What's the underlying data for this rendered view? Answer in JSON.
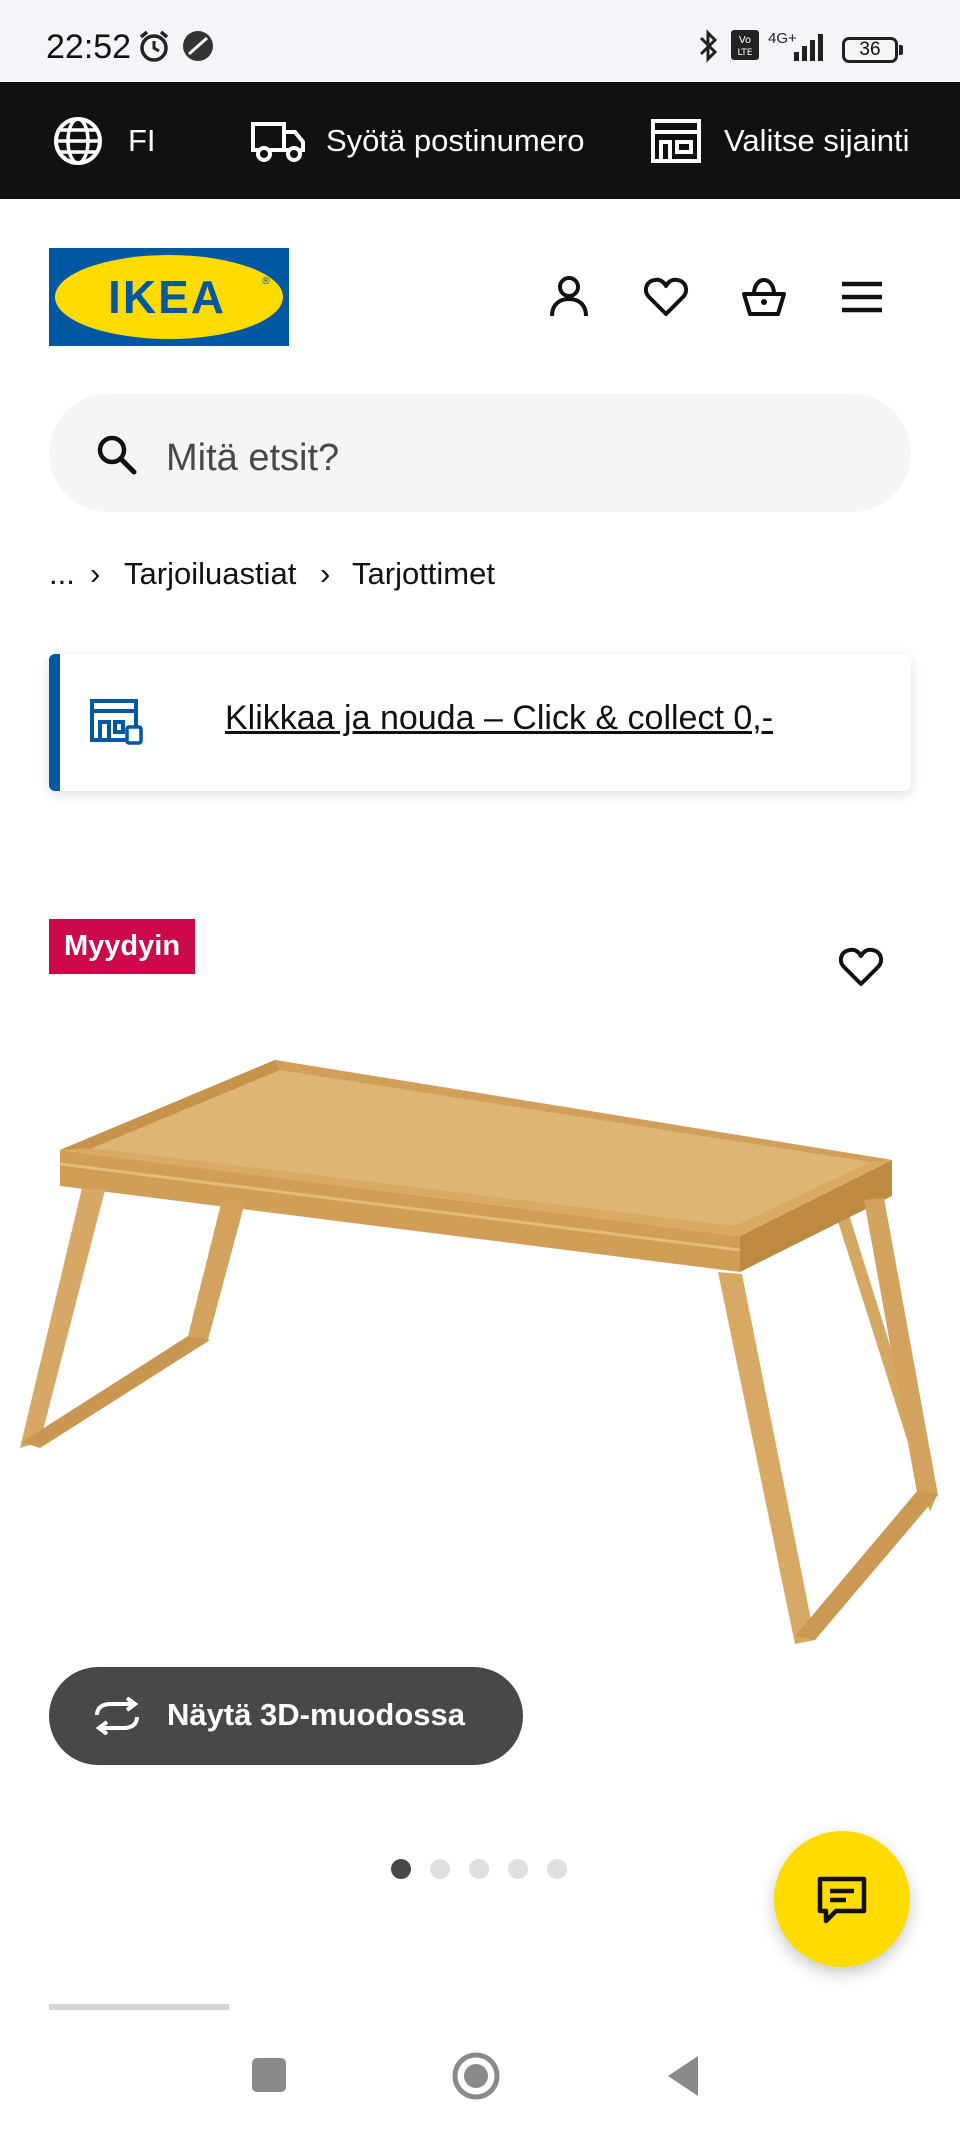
{
  "status_bar": {
    "time": "22:52",
    "battery": "36",
    "network": "4G+"
  },
  "top_bar": {
    "language": "FI",
    "postal_code_label": "Syötä postinumero",
    "location_label": "Valitse sijainti"
  },
  "header": {
    "logo_text": "IKEA"
  },
  "search": {
    "placeholder": "Mitä etsit?"
  },
  "breadcrumb": {
    "ellipsis": "...",
    "items": [
      "Tarjoiluastiat",
      "Tarjottimet"
    ]
  },
  "promo": {
    "text": "Klikkaa ja nouda – Click & collect 0,-"
  },
  "product": {
    "badge": "Myydyin",
    "view_3d_label": "Näytä 3D-muodossa",
    "image_count": 5,
    "active_image": 1
  },
  "colors": {
    "brand_blue": "#0058a3",
    "brand_yellow": "#ffdb00",
    "badge_red": "#cc0a4b",
    "topbar_black": "#111111"
  }
}
